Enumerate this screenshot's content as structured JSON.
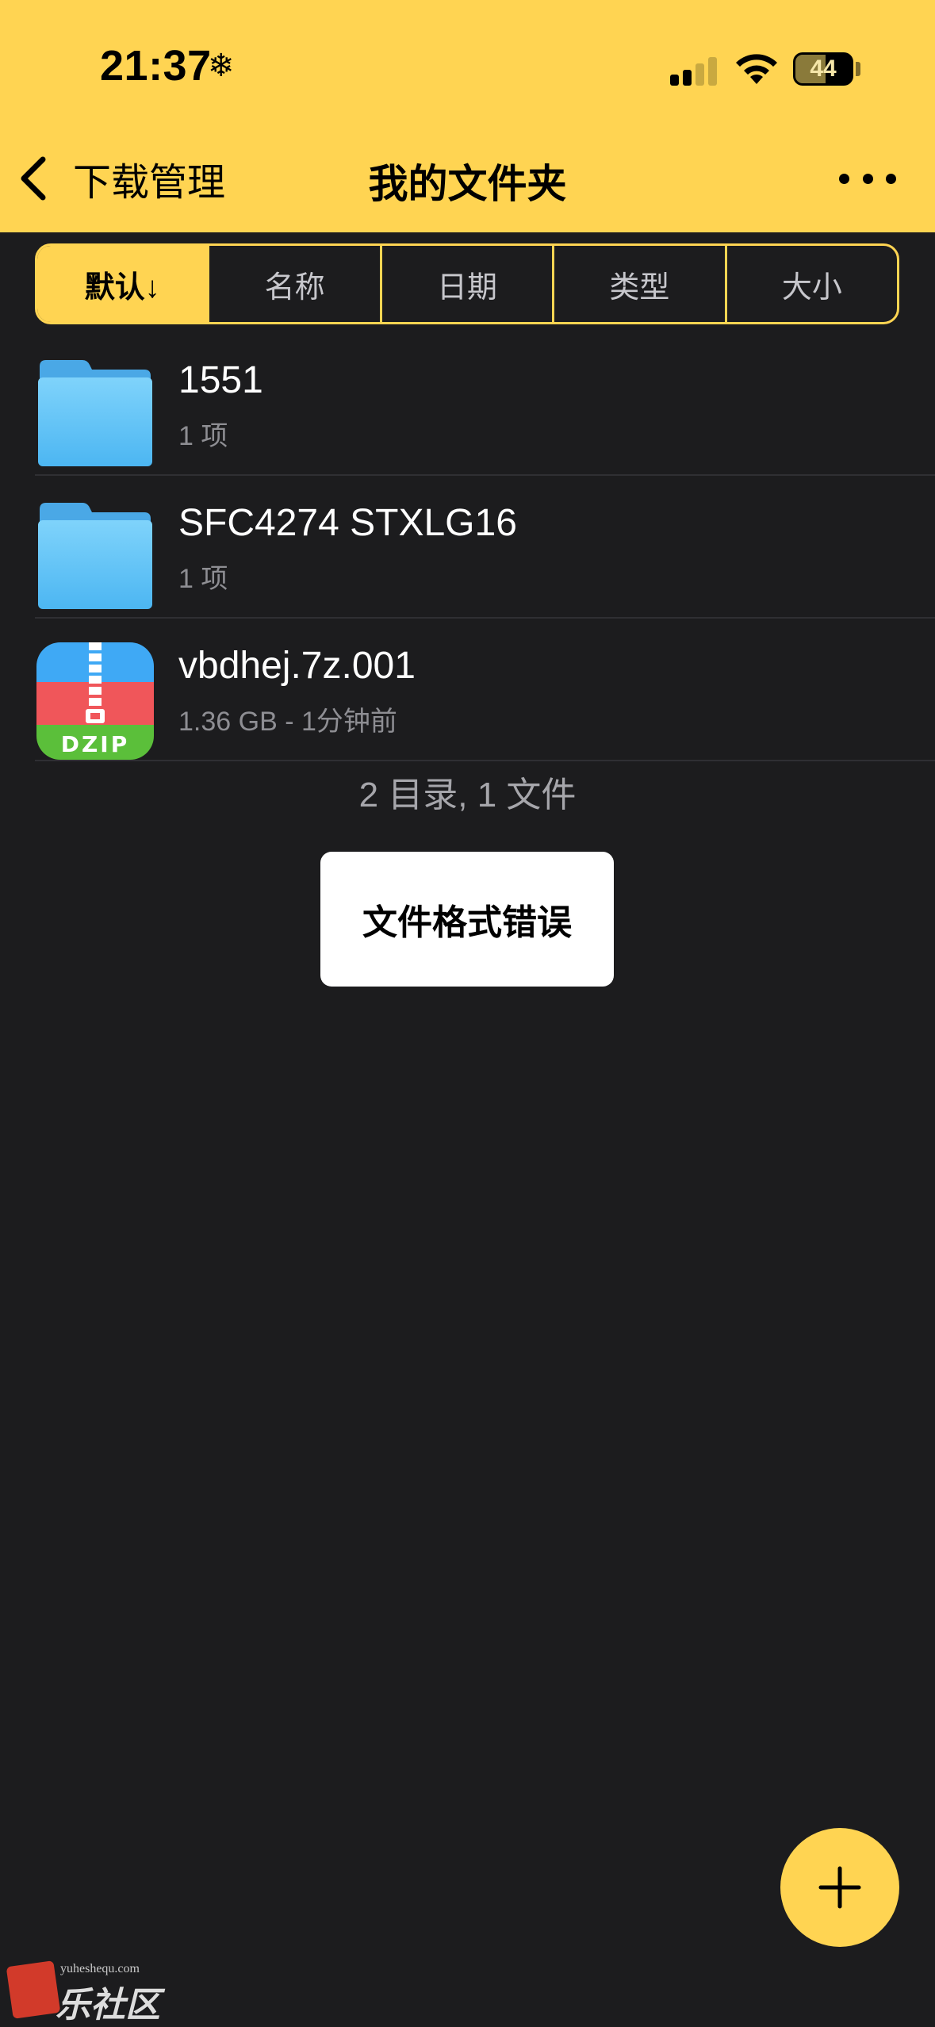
{
  "status_bar": {
    "time": "21:37",
    "focus_glyph": "❄",
    "battery_level": "44",
    "battery_percent": 44,
    "signal_bars_active": 2,
    "signal_bars_total": 4
  },
  "nav": {
    "back_label": "下载管理",
    "title": "我的文件夹"
  },
  "sort": {
    "options": [
      {
        "label": "默认↓",
        "active": true
      },
      {
        "label": "名称",
        "active": false
      },
      {
        "label": "日期",
        "active": false
      },
      {
        "label": "类型",
        "active": false
      },
      {
        "label": "大小",
        "active": false
      }
    ]
  },
  "files": [
    {
      "name": "1551",
      "meta": "1 项",
      "icon": "folder-icon"
    },
    {
      "name": "SFC4274 STXLG16",
      "meta": "1 项",
      "icon": "folder-icon"
    },
    {
      "name": "vbdhej.7z.001",
      "meta": "1.36 GB - 1分钟前",
      "icon": "dzip-archive-icon",
      "icon_label": "DZIP"
    }
  ],
  "summary": "2 目录, 1 文件",
  "toast": "文件格式错误",
  "fab": {
    "icon": "plus-icon"
  },
  "watermark": {
    "small": "yuheshequ.com",
    "big": "乐社区"
  },
  "colors": {
    "accent": "#ffd452",
    "background": "#1c1c1e",
    "folder_blue": "#5ac8fa",
    "dzip_blue": "#3fa9f5",
    "dzip_red": "#f0565a",
    "dzip_green": "#5bbf3a"
  }
}
